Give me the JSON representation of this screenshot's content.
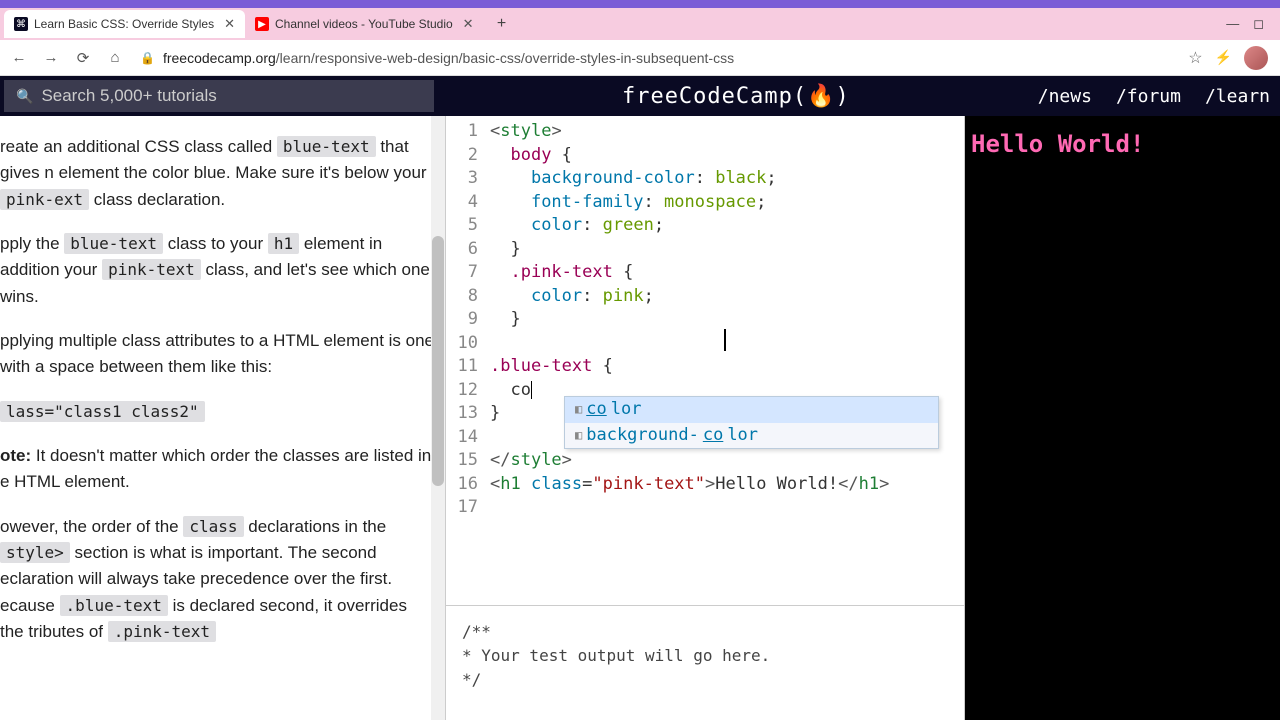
{
  "browser": {
    "tabs": [
      {
        "title": "Learn Basic CSS: Override Styles",
        "favicon": "fcc",
        "active": true
      },
      {
        "title": "Channel videos - YouTube Studio",
        "favicon": "yt",
        "active": false
      }
    ],
    "url_domain": "freecodecamp.org",
    "url_path": "/learn/responsive-web-design/basic-css/override-styles-in-subsequent-css"
  },
  "fcc_nav": {
    "search_placeholder": "Search 5,000+ tutorials",
    "brand": "freeCodeCamp(🔥)",
    "links": [
      "/news",
      "/forum",
      "/learn"
    ]
  },
  "instructions": {
    "p1_a": "reate an additional CSS class called ",
    "p1_code1": "blue-text",
    "p1_b": " that gives n element the color blue. Make sure it's below your ",
    "p1_code2": "pink-ext",
    "p1_c": " class declaration.",
    "p2_a": "pply the ",
    "p2_code1": "blue-text",
    "p2_b": " class to your ",
    "p2_code2": "h1",
    "p2_c": " element in addition  your ",
    "p2_code3": "pink-text",
    "p2_d": " class, and let's see which one wins.",
    "p3": "pplying multiple class attributes to a HTML element is one with a space between them like this:",
    "p4_code": "lass=\"class1 class2\"",
    "p5_a": "ote: ",
    "p5_b": "It doesn't matter which order the classes are listed in e HTML element.",
    "p6_a": "owever, the order of the ",
    "p6_code1": "class",
    "p6_b": " declarations in the ",
    "p6_code2": "style>",
    "p6_c": " section is what is important. The second eclaration will always take precedence over the first. ecause ",
    "p6_code3": ".blue-text",
    "p6_d": " is declared second, it overrides the tributes of ",
    "p6_code4": ".pink-text"
  },
  "editor": {
    "line_count": 17,
    "typed_partial": "co",
    "autocomplete": [
      {
        "prefix": "co",
        "rest": "lor",
        "selected": true
      },
      {
        "prefix": "background-",
        "match": "co",
        "rest": "lor",
        "selected": false
      }
    ]
  },
  "console": {
    "text": "/**\n* Your test output will go here.\n*/"
  },
  "preview": {
    "heading": "Hello World!"
  }
}
